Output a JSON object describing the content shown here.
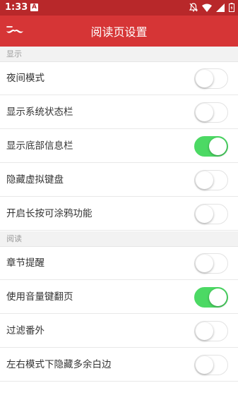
{
  "status_bar": {
    "time": "1:33",
    "notification_letter": "A"
  },
  "app_bar": {
    "title": "阅读页设置",
    "back_icon": "mustache-back-icon"
  },
  "sections": [
    {
      "header": "显示",
      "items": [
        {
          "label": "夜间模式",
          "on": false
        },
        {
          "label": "显示系统状态栏",
          "on": false
        },
        {
          "label": "显示底部信息栏",
          "on": true
        },
        {
          "label": "隐藏虚拟键盘",
          "on": false
        },
        {
          "label": "开启长按可涂鸦功能",
          "on": false
        }
      ]
    },
    {
      "header": "阅读",
      "items": [
        {
          "label": "章节提醒",
          "on": false
        },
        {
          "label": "使用音量键翻页",
          "on": true
        },
        {
          "label": "过滤番外",
          "on": false
        },
        {
          "label": "左右模式下隐藏多余白边",
          "on": false
        }
      ]
    }
  ],
  "colors": {
    "status_bar": "#b8282a",
    "app_bar": "#d63536",
    "toggle_on": "#4cd964"
  }
}
